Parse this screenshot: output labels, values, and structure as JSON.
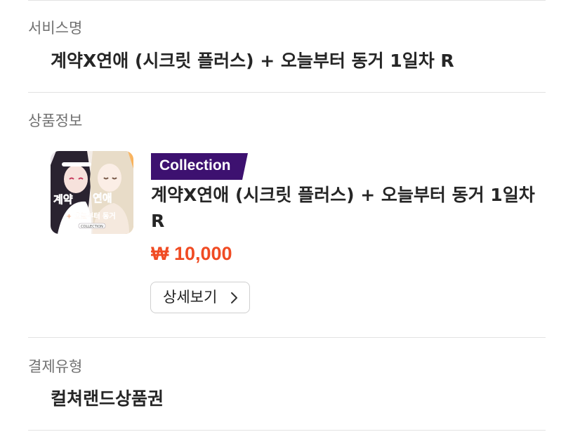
{
  "service": {
    "label": "서비스명",
    "value": "계약X연애 (시크릿 플러스) + 오늘부터 동거 1일차 R"
  },
  "product": {
    "label": "상품정보",
    "badge": "Collection",
    "title": "계약X연애 (시크릿 플러스) + 오늘부터 동거 1일차 R",
    "price": "₩ 10,000",
    "detail_button": "상세보기",
    "thumbnail_icon": "product-cover-illustration",
    "thumbnail_text": {
      "title_left": "계약",
      "title_right": "연애",
      "subtitle": "+ 오늘부터 동거",
      "footer": "COLLECTION"
    }
  },
  "payment": {
    "label": "결제유형",
    "value": "컬쳐랜드상품권"
  },
  "colors": {
    "badge_bg": "#3d1170",
    "price": "#f04b23",
    "divider": "#e2e2e2",
    "label": "#707070"
  }
}
